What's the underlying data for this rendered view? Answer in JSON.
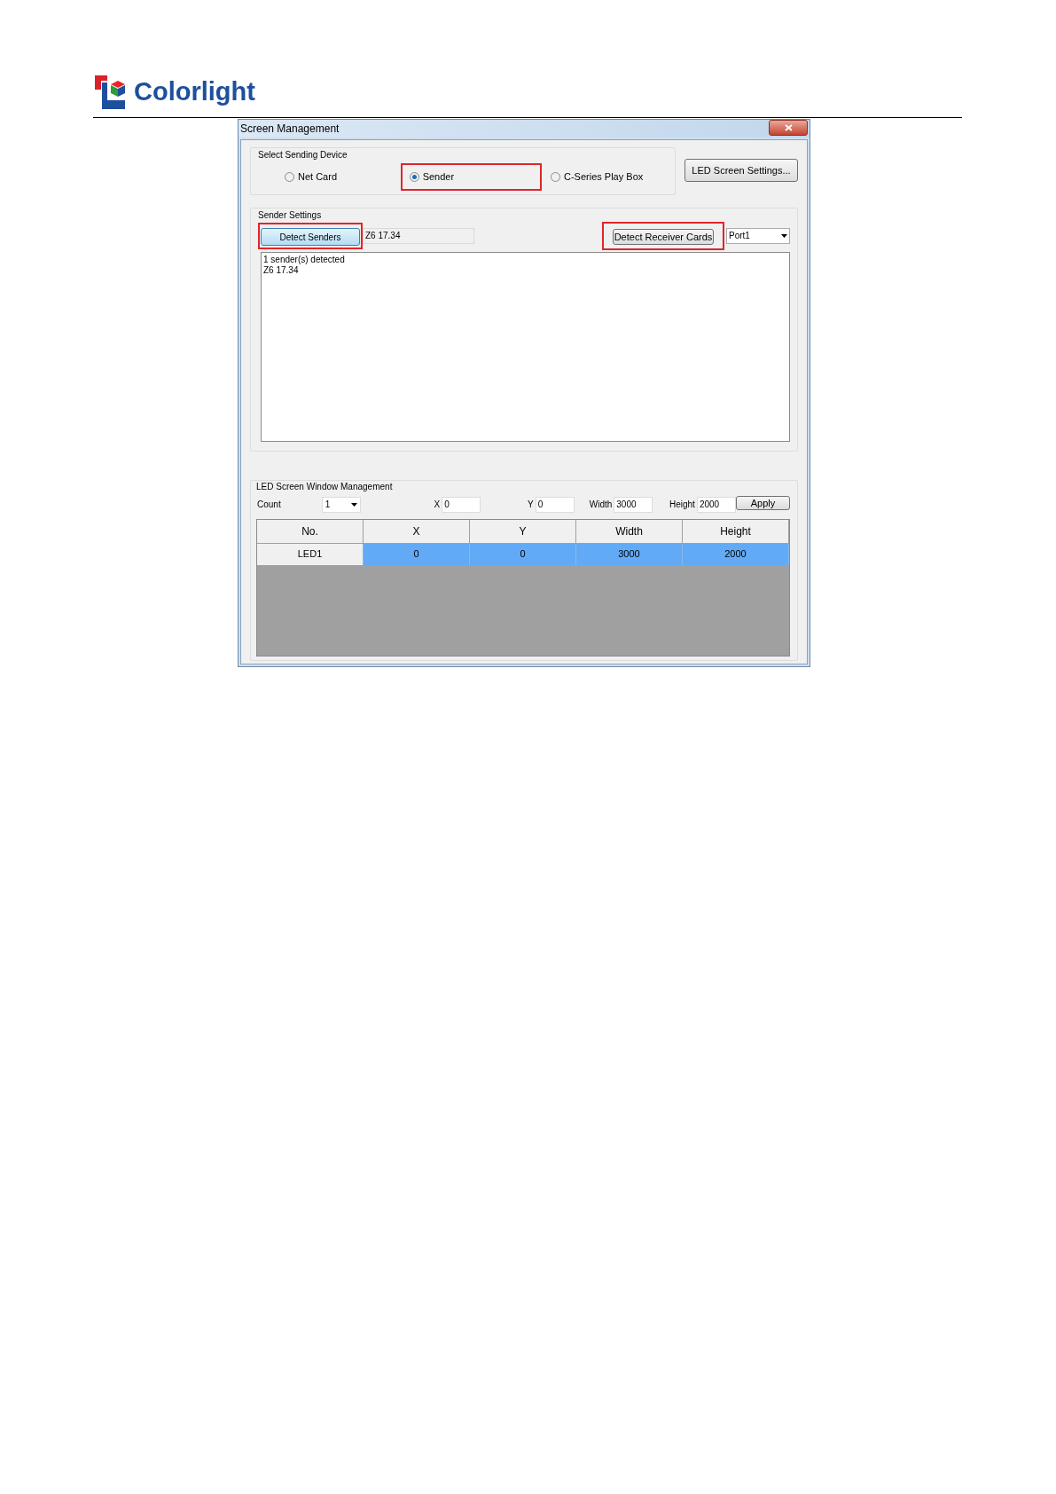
{
  "logo": {
    "text": "Colorlight"
  },
  "window": {
    "title": "Screen Management"
  },
  "sending_device": {
    "title": "Select Sending Device",
    "options": [
      {
        "label": "Net Card",
        "selected": false,
        "highlighted": false
      },
      {
        "label": "Sender",
        "selected": true,
        "highlighted": true
      },
      {
        "label": "C-Series Play Box",
        "selected": false,
        "highlighted": false
      }
    ],
    "settings_button": {
      "label": "LED Screen Settings..."
    }
  },
  "sender_settings": {
    "title": "Sender Settings",
    "detect_senders": {
      "label": "Detect Senders",
      "highlighted": true
    },
    "sender_field": {
      "value": "Z6 17.34"
    },
    "detect_receivers": {
      "label": "Detect Receiver Cards",
      "highlighted": true
    },
    "port_select": {
      "value": "Port1"
    },
    "log": [
      "1 sender(s) detected",
      "Z6 17.34"
    ]
  },
  "window_management": {
    "title": "LED Screen Window Management",
    "fields": [
      {
        "kind": "select",
        "label": "Count",
        "value": "1"
      },
      {
        "kind": "input",
        "label": "X",
        "value": "0"
      },
      {
        "kind": "input",
        "label": "Y",
        "value": "0"
      },
      {
        "kind": "input",
        "label": "Width",
        "value": "3000"
      },
      {
        "kind": "input",
        "label": "Height",
        "value": "2000"
      }
    ],
    "apply_button": {
      "label": "Apply"
    },
    "table": {
      "columns": [
        "No.",
        "X",
        "Y",
        "Width",
        "Height"
      ],
      "rows": [
        {
          "cells": [
            "LED1",
            "0",
            "0",
            "3000",
            "2000"
          ],
          "selected": true
        }
      ]
    }
  }
}
